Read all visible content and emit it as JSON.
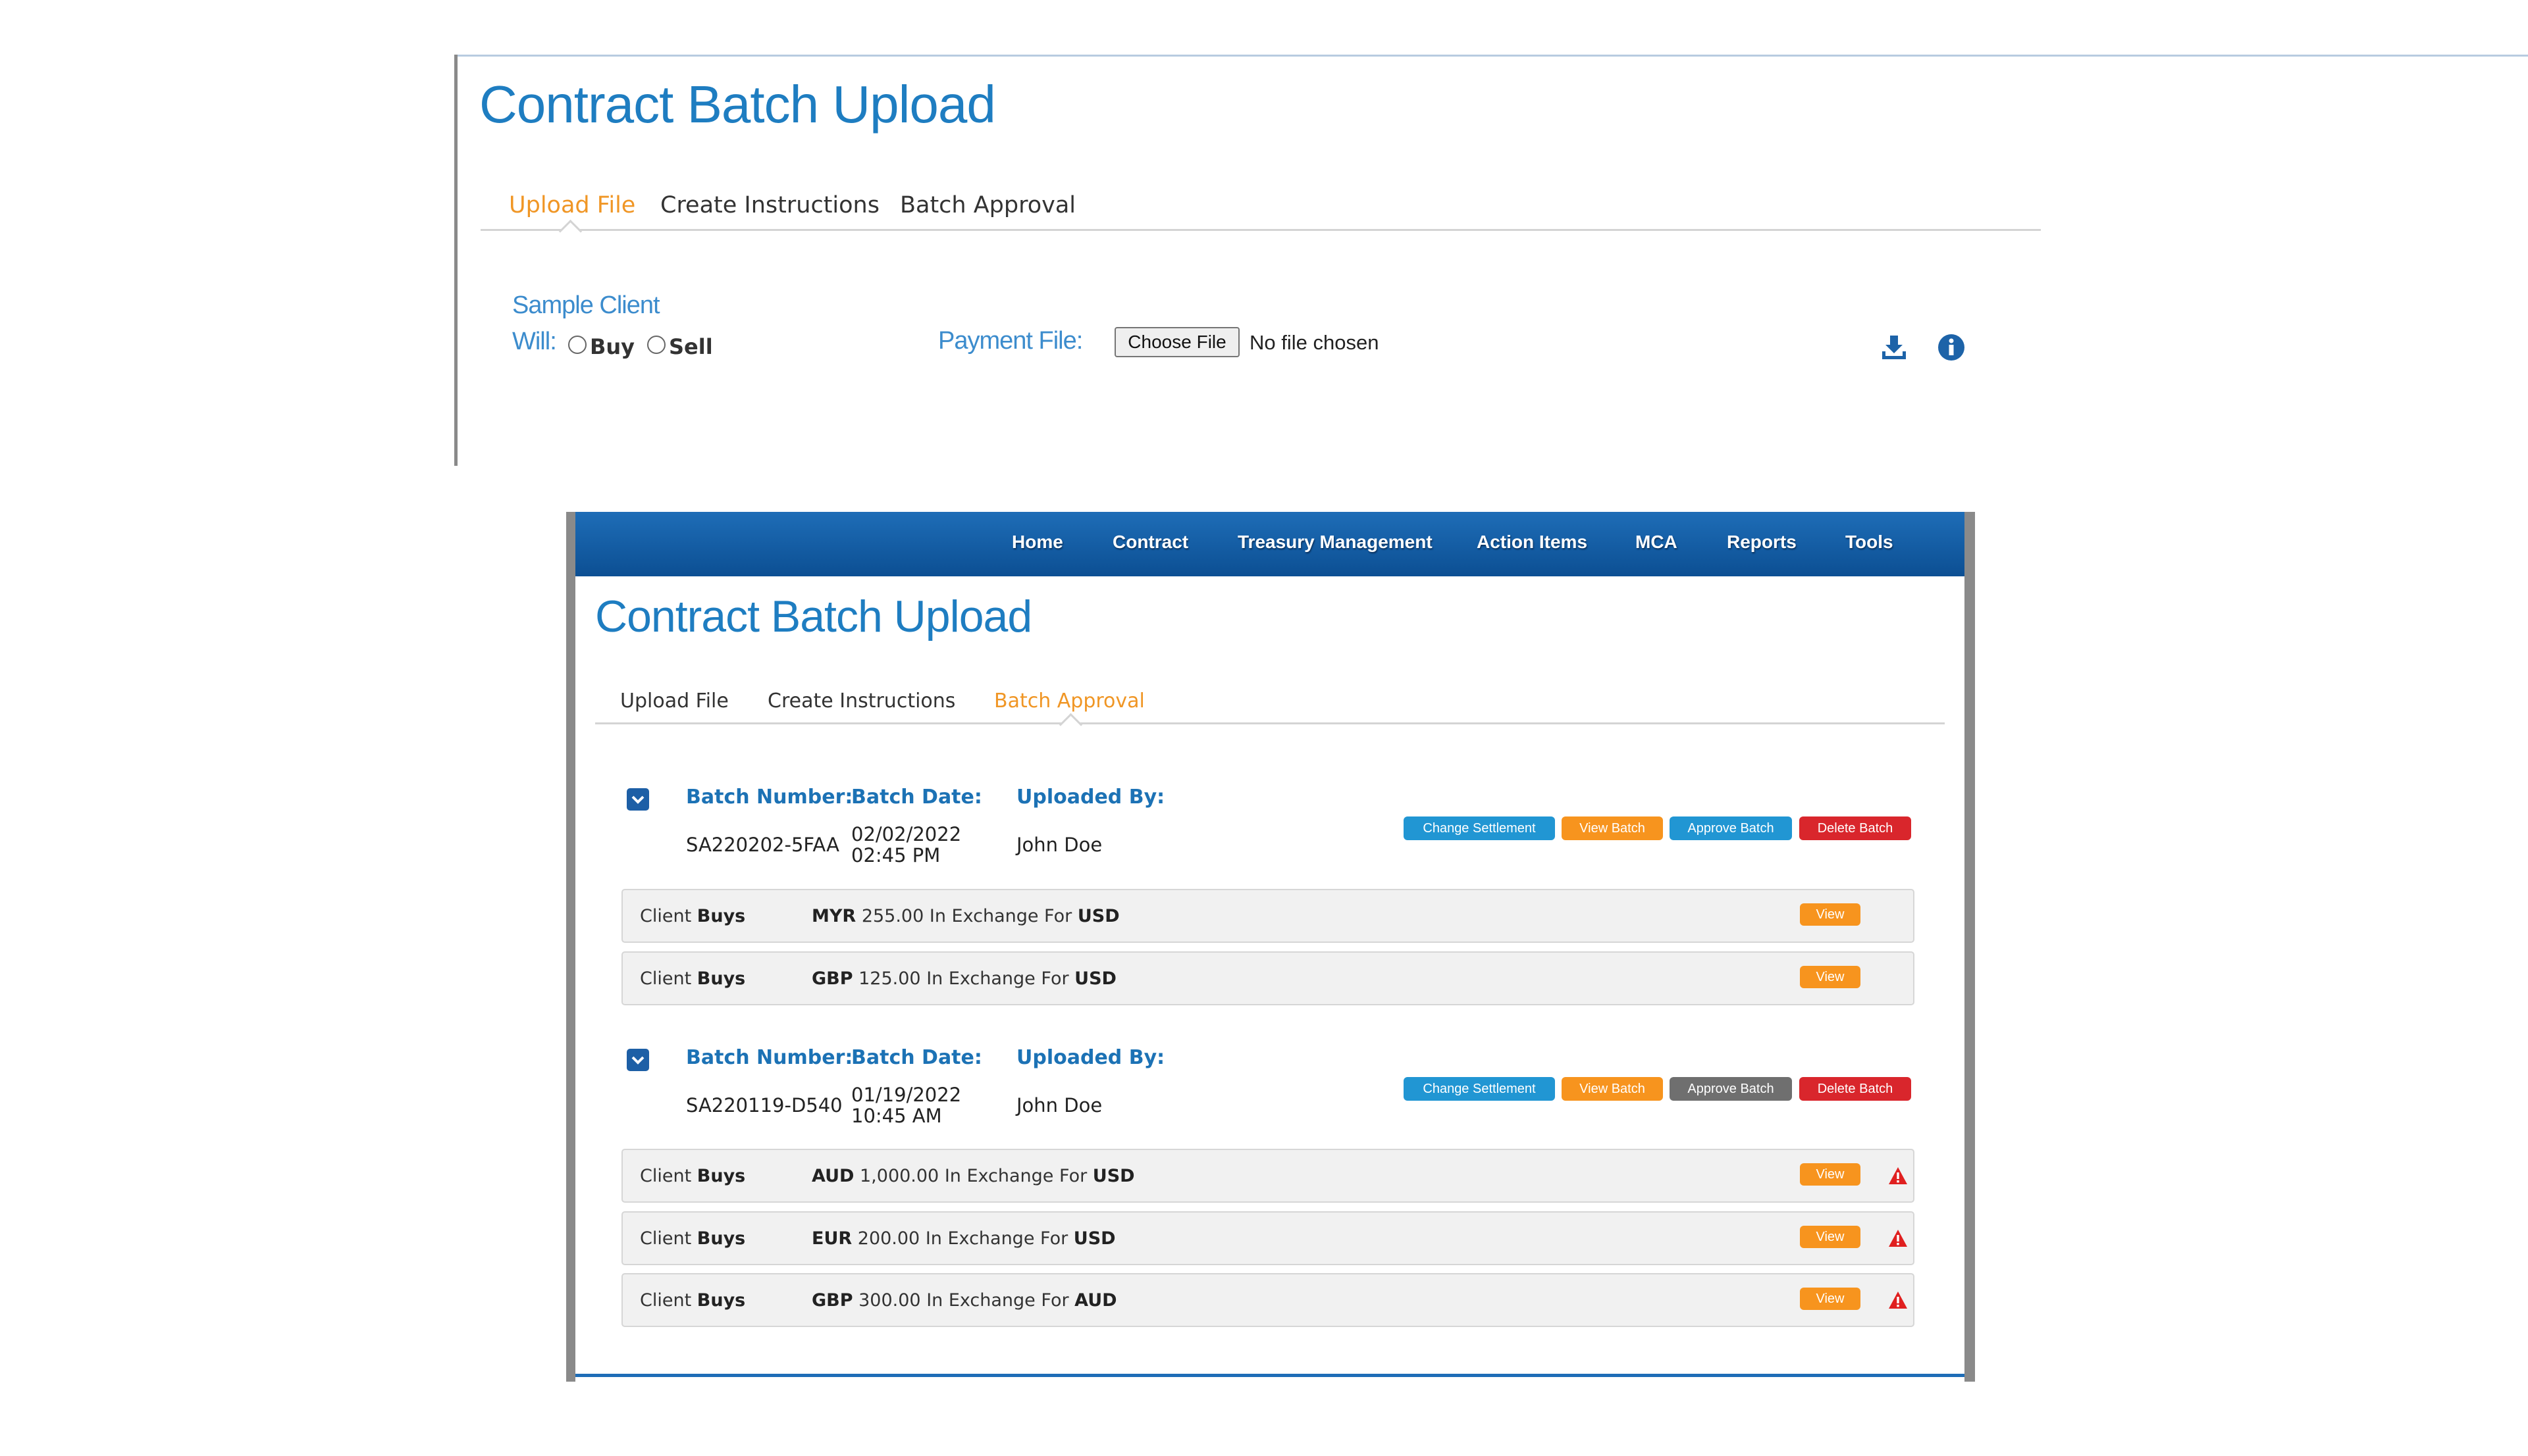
{
  "panel1": {
    "title": "Contract Batch Upload",
    "tabs": [
      {
        "label": "Upload File",
        "active": true
      },
      {
        "label": "Create Instructions",
        "active": false
      },
      {
        "label": "Batch Approval",
        "active": false
      }
    ],
    "client_name": "Sample Client",
    "will_label": "Will:",
    "radio_buy": "Buy",
    "radio_sell": "Sell",
    "payment_file_label": "Payment File:",
    "choose_file_label": "Choose File",
    "no_file_text": "No file chosen",
    "icons": [
      "download-icon",
      "info-icon"
    ]
  },
  "panel2": {
    "nav": [
      "Home",
      "Contract",
      "Treasury Management",
      "Action Items",
      "MCA",
      "Reports",
      "Tools"
    ],
    "title": "Contract Batch Upload",
    "tabs": [
      {
        "label": "Upload File",
        "active": false
      },
      {
        "label": "Create Instructions",
        "active": false
      },
      {
        "label": "Batch Approval",
        "active": true
      }
    ],
    "headers": {
      "batch_number": "Batch Number:",
      "batch_date": "Batch Date:",
      "uploaded_by": "Uploaded By:"
    },
    "buttons": {
      "change_settlement": "Change Settlement",
      "view_batch": "View Batch",
      "approve_batch": "Approve Batch",
      "delete_batch": "Delete Batch"
    },
    "view_label": "View",
    "exchange_text": "In Exchange For",
    "batches": [
      {
        "number": "SA220202-5FAA",
        "date": "02/02/2022",
        "time": "02:45 PM",
        "uploaded_by": "John Doe",
        "approve_enabled": true,
        "rows": [
          {
            "client": "Client",
            "side": "Buys",
            "currency": "MYR",
            "amount": "255.00",
            "for_currency": "USD",
            "warning": false
          },
          {
            "client": "Client",
            "side": "Buys",
            "currency": "GBP",
            "amount": "125.00",
            "for_currency": "USD",
            "warning": false
          }
        ]
      },
      {
        "number": "SA220119-D540",
        "date": "01/19/2022",
        "time": "10:45 AM",
        "uploaded_by": "John Doe",
        "approve_enabled": false,
        "rows": [
          {
            "client": "Client",
            "side": "Buys",
            "currency": "AUD",
            "amount": "1,000.00",
            "for_currency": "USD",
            "warning": true
          },
          {
            "client": "Client",
            "side": "Buys",
            "currency": "EUR",
            "amount": "200.00",
            "for_currency": "USD",
            "warning": true
          },
          {
            "client": "Client",
            "side": "Buys",
            "currency": "GBP",
            "amount": "300.00",
            "for_currency": "AUD",
            "warning": true
          }
        ]
      }
    ]
  },
  "colors": {
    "title_blue": "#1e7dc1",
    "active_tab": "#f09625",
    "nav_blue": "#1e6db7",
    "btn_blue": "#2196d3",
    "btn_orange": "#f7941e",
    "btn_red": "#d9262c",
    "btn_gray": "#6f6f6f",
    "warning_red": "#e02020"
  }
}
